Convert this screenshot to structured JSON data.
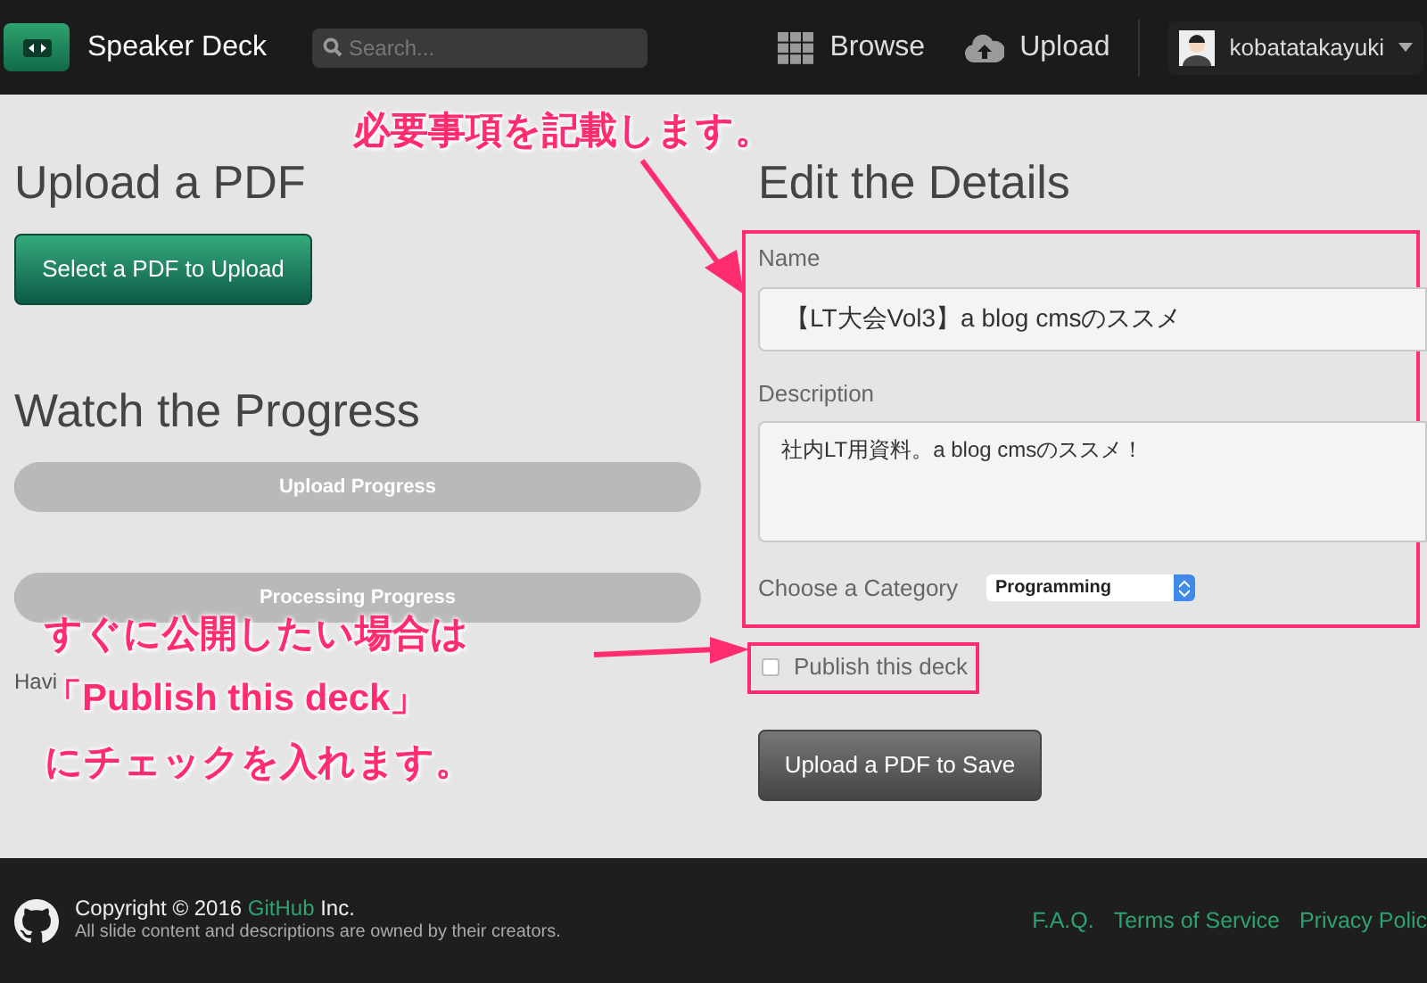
{
  "header": {
    "brand": "Speaker Deck",
    "search": {
      "placeholder": "Search..."
    },
    "nav": [
      {
        "kind": "grid",
        "label": "Browse"
      },
      {
        "kind": "cloud",
        "label": "Upload"
      }
    ],
    "user": "kobatatakayuki"
  },
  "left": {
    "upload_title": "Upload a PDF",
    "select_button": "Select a PDF to Upload",
    "progress_title": "Watch the Progress",
    "progress_bars": [
      {
        "label": "Upload Progress",
        "level": 0
      },
      {
        "label": "Processing Progress",
        "level": 0
      }
    ],
    "note": "Havi"
  },
  "right": {
    "title": "Edit the Details",
    "name_label": "Name",
    "name_value": "【LT大会Vol3】a blog cmsのススメ",
    "description_label": "Description",
    "description_value": "社内LT用資料。a blog cmsのススメ！",
    "category_label": "Choose a Category",
    "category_value": "Programming",
    "publish": {
      "label": "Publish this deck",
      "checked": false
    },
    "save_button": "Upload a PDF to Save"
  },
  "annotations": [
    {
      "lines": [
        "必要事項を記載します。"
      ]
    },
    {
      "lines": [
        "すぐに公開したい場合は",
        "「Publish this deck」",
        "にチェックを入れます。"
      ]
    }
  ],
  "footer": {
    "copyright_before": "Copyright © 2016 ",
    "copyright_link": "GitHub",
    "copyright_after": " Inc.",
    "notice": "All slide content and descriptions are owned by their creators.",
    "links": [
      "F.A.Q.",
      "Terms of Service",
      "Privacy Polic"
    ]
  }
}
